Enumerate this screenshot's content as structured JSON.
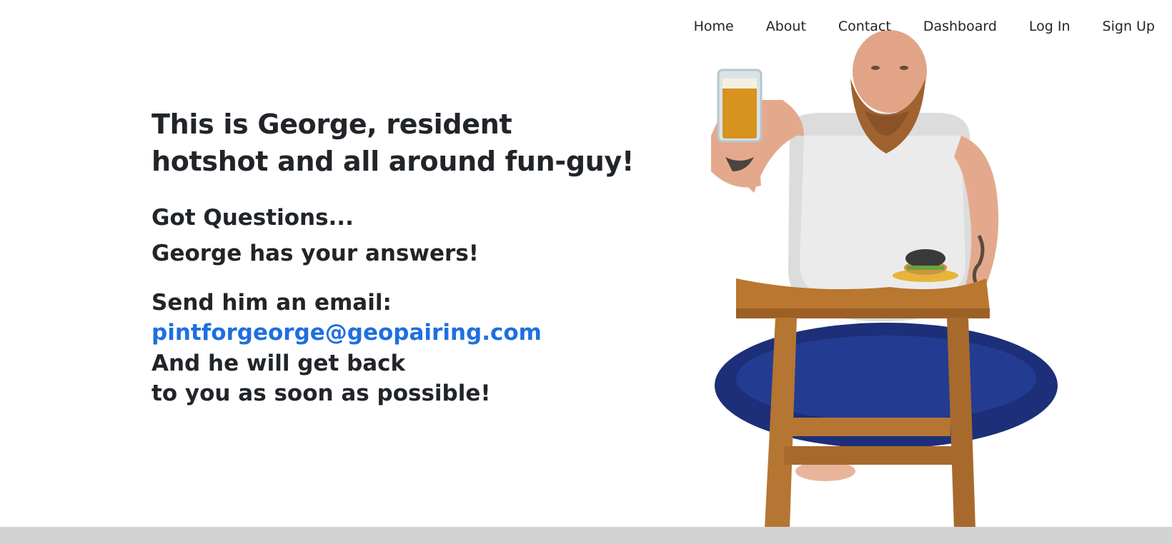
{
  "nav": {
    "items": [
      "Home",
      "About",
      "Contact",
      "Dashboard",
      "Log In",
      "Sign Up"
    ]
  },
  "hero": {
    "headline_line1": "This is George, resident",
    "headline_line2": "hotshot and all around fun-guy!",
    "questions": "Got Questions...",
    "answers": "George has your answers!",
    "send_email": "Send him an email:",
    "email": "pintforgeorge@geopairing.com",
    "back_line1": "And he will get back",
    "back_line2": "to you as soon as possible!"
  },
  "illustration": {
    "icon": "man-with-beer-on-stool-photo"
  },
  "colors": {
    "text": "#212529",
    "link": "#1f6fe0",
    "footer": "#d3d3d3",
    "background": "#ffffff"
  }
}
